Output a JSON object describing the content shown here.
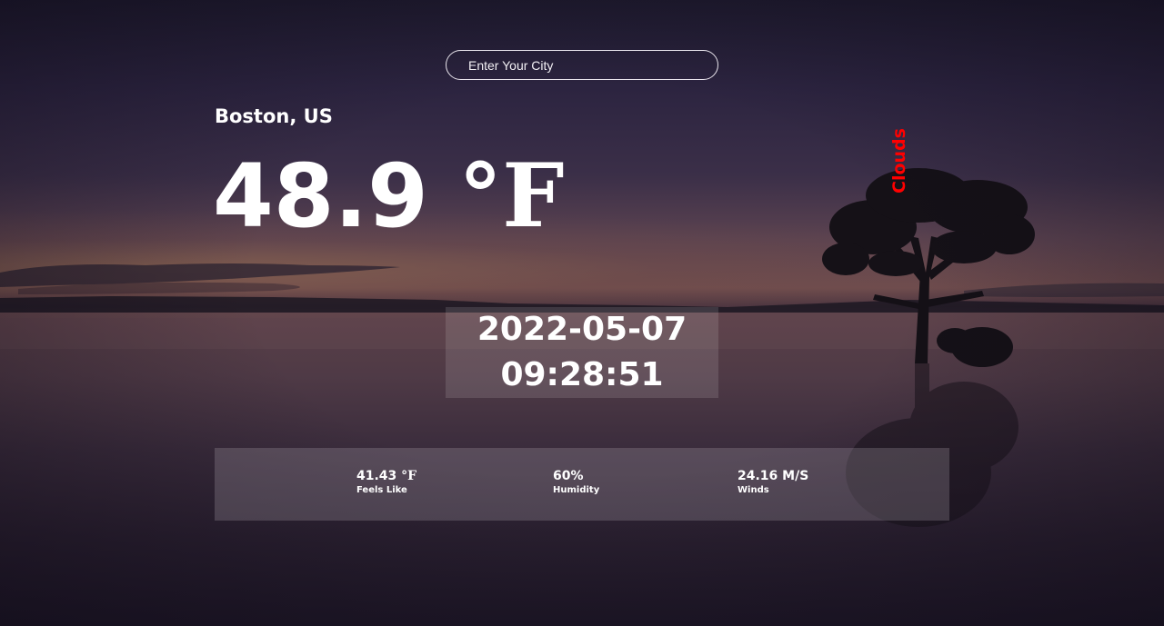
{
  "search": {
    "placeholder": "Enter Your City"
  },
  "location": {
    "city": "Boston, US"
  },
  "current": {
    "temperature": "48.9",
    "temperature_unit": "°F",
    "condition": "Clouds",
    "condition_color": "#ff0000"
  },
  "clock": {
    "date": "2022-05-07",
    "time": "09:28:51"
  },
  "details": {
    "feels_like": {
      "value": "41.43",
      "unit": "°F",
      "label": "Feels Like"
    },
    "humidity": {
      "value": "60%",
      "label": "Humidity"
    },
    "winds": {
      "value": "24.16 M/S",
      "label": "Winds"
    }
  },
  "background": {
    "scene": "lake-sunset-tree",
    "text_color": "#ffffff"
  }
}
